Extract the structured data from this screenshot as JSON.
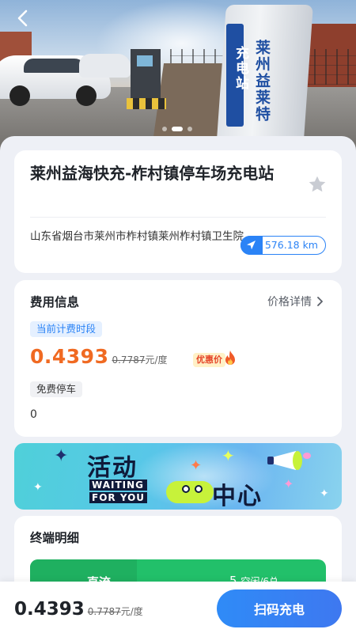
{
  "hero": {
    "sign_text_main": "莱州益莱特",
    "sign_text_side": "充电站",
    "carousel_count": 3,
    "carousel_active_index": 1
  },
  "station": {
    "name": "莱州益海快充-柞村镇停车场充电站",
    "address": "山东省烟台市莱州市柞村镇莱州柞村镇卫生院",
    "distance": "576.18 km",
    "favorited": false
  },
  "fee": {
    "section_title": "费用信息",
    "detail_link": "价格详情",
    "current_period_label": "当前计费时段",
    "price": "0.4393",
    "original_price": "0.7787",
    "unit": "元/度",
    "promo_badge": "优惠价",
    "parking_label": "免费停车",
    "parking_value": "0"
  },
  "banner": {
    "title_part1": "活动",
    "title_part2": "中心",
    "tagline_line1": "WAITING",
    "tagline_line2": "FOR YOU"
  },
  "terminals": {
    "section_title": "终端明细",
    "type": "直流",
    "available_count": "5",
    "count_text": "空闲/6总"
  },
  "bottom": {
    "price": "0.4393",
    "original_price": "0.7787",
    "unit": "元/度",
    "scan_button": "扫码充电"
  },
  "colors": {
    "primary_blue": "#2b83f6",
    "price_orange": "#f06a22",
    "terminal_green": "#22c06a"
  }
}
